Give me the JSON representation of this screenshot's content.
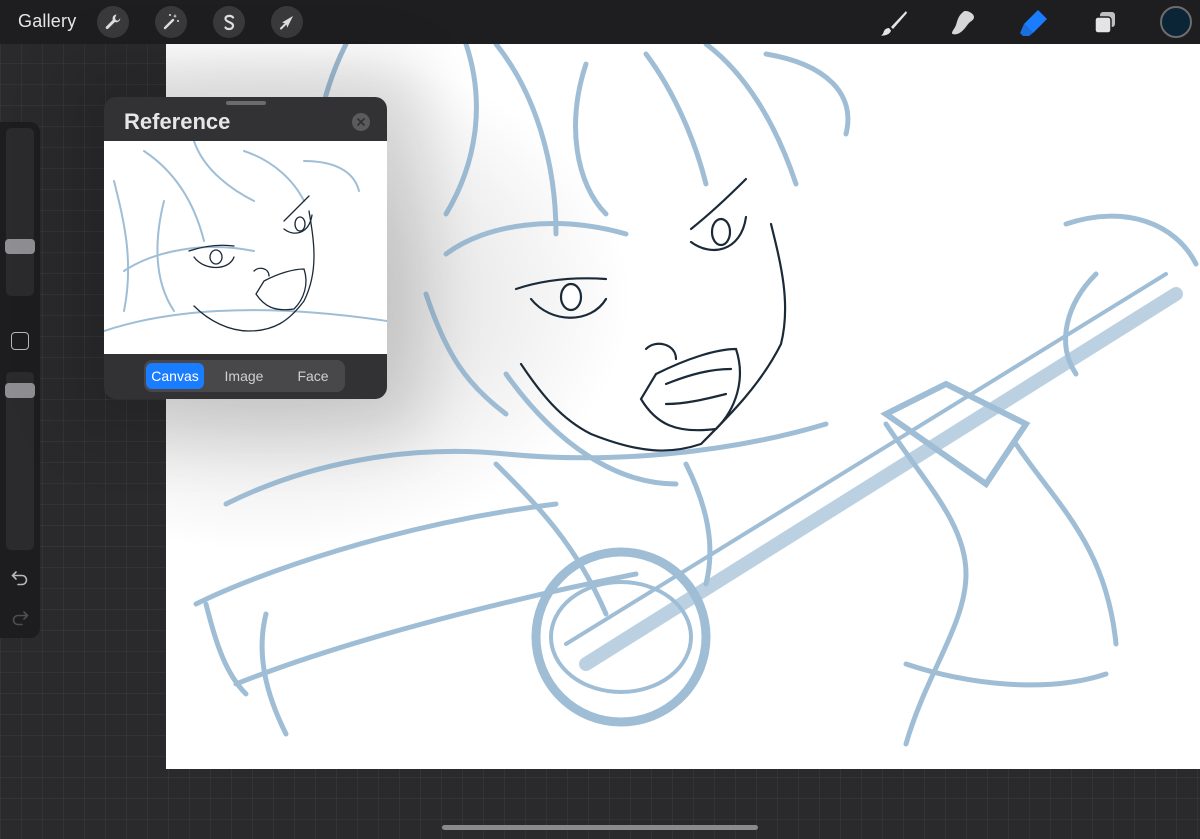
{
  "topbar": {
    "gallery_label": "Gallery",
    "left_tools": [
      "wrench-icon",
      "magic-wand-icon",
      "selection-icon",
      "transform-arrow-icon"
    ],
    "right_tools": [
      "brush-icon",
      "smudge-icon",
      "eraser-icon",
      "layers-icon"
    ],
    "active_tool": "eraser-icon",
    "current_color": "#0b2436"
  },
  "sidebar": {
    "brush_size_level": 0.7,
    "opacity_level": 0.95,
    "icons": [
      "square-modify-icon",
      "undo-icon",
      "redo-icon"
    ]
  },
  "reference": {
    "title": "Reference",
    "tabs": [
      {
        "label": "Canvas",
        "active": true
      },
      {
        "label": "Image",
        "active": false
      },
      {
        "label": "Face",
        "active": false
      }
    ]
  },
  "colors": {
    "accent": "#1a7cff",
    "sketch_blue": "#8fb3cf",
    "ink": "#1b2a38"
  }
}
